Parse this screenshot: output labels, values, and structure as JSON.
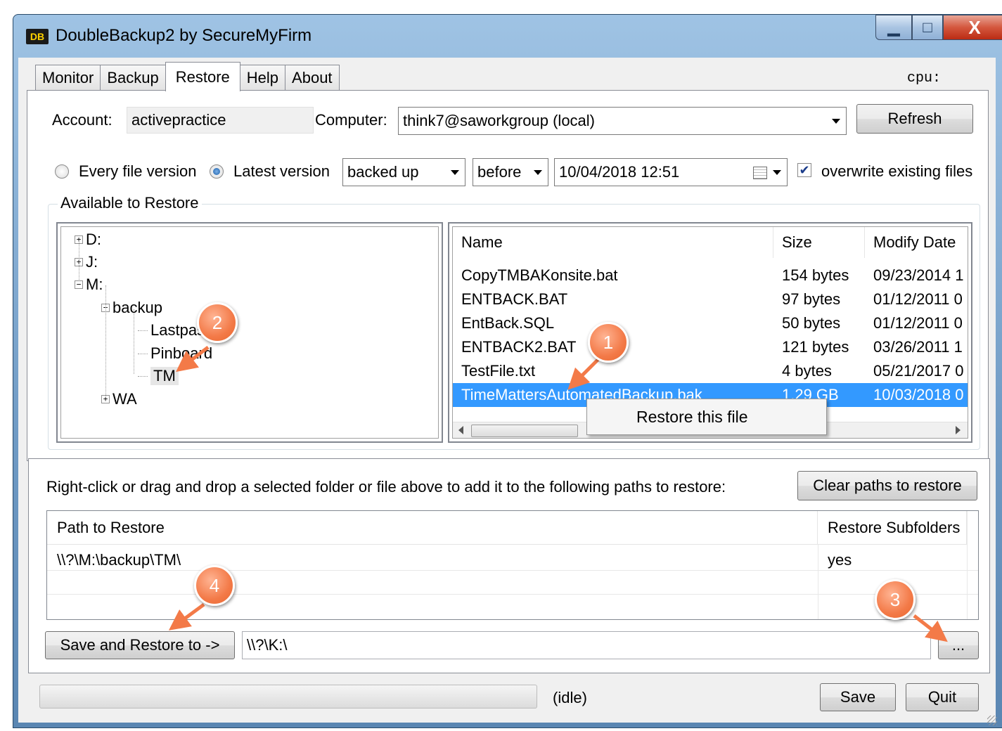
{
  "window": {
    "title": "DoubleBackup2 by SecureMyFirm",
    "icon_text": "DB"
  },
  "caption_buttons": {
    "minimize": "▁",
    "maximize": "□",
    "close": "X"
  },
  "tabs": [
    {
      "label": "Monitor"
    },
    {
      "label": "Backup"
    },
    {
      "label": "Restore"
    },
    {
      "label": "Help"
    },
    {
      "label": "About"
    }
  ],
  "cpu_label": "cpu:",
  "account": {
    "label": "Account:",
    "value": "activepractice"
  },
  "computer": {
    "label": "Computer:",
    "value": "think7@saworkgroup (local)"
  },
  "refresh_label": "Refresh",
  "version_options": {
    "every": "Every file version",
    "latest": "Latest version",
    "selected": "latest"
  },
  "filter": {
    "mode": "backed up",
    "relation": "before",
    "datetime": "10/04/2018   12:51"
  },
  "overwrite": {
    "label": "overwrite existing files",
    "checked": true
  },
  "available_title": "Available to Restore",
  "tree": {
    "d": "D:",
    "j": "J:",
    "m": "M:",
    "backup": "backup",
    "lastpass": "Lastpass",
    "pinboard": "Pinboard",
    "tm": "TM",
    "wa": "WA"
  },
  "file_list": {
    "headers": {
      "name": "Name",
      "size": "Size",
      "modify": "Modify Date"
    },
    "rows": [
      {
        "name": "CopyTMBAKonsite.bat",
        "size": "154 bytes",
        "date": "09/23/2014 1"
      },
      {
        "name": "ENTBACK.BAT",
        "size": "97 bytes",
        "date": "01/12/2011 0"
      },
      {
        "name": "EntBack.SQL",
        "size": "50 bytes",
        "date": "01/12/2011 0"
      },
      {
        "name": "ENTBACK2.BAT",
        "size": "121 bytes",
        "date": "03/26/2011 1"
      },
      {
        "name": "TestFile.txt",
        "size": "4 bytes",
        "date": "05/21/2017 0"
      },
      {
        "name": "TimeMattersAutomatedBackup.bak",
        "size": "1.29 GB",
        "date": "10/03/2018 0"
      }
    ]
  },
  "context_menu": {
    "item": "Restore this file"
  },
  "instructions": "Right-click or drag and drop a selected folder or file above to add it to the following paths to restore:",
  "clear_paths_label": "Clear paths to restore",
  "paths_grid": {
    "headers": {
      "path": "Path to Restore",
      "subfolders": "Restore Subfolders"
    },
    "rows": [
      {
        "path": "\\\\?\\M:\\backup\\TM\\",
        "subfolders": "yes"
      }
    ]
  },
  "save_restore_label": "Save and Restore to ->",
  "restore_target": "\\\\?\\K:\\",
  "browse_label": "...",
  "status_text": "(idle)",
  "save_label": "Save",
  "quit_label": "Quit",
  "progress": 0,
  "badges": {
    "one": "1",
    "two": "2",
    "three": "3",
    "four": "4"
  },
  "colors": {
    "selection": "#3399ff",
    "badge": "#f37a48",
    "title_bar": "#9fc3e4"
  }
}
